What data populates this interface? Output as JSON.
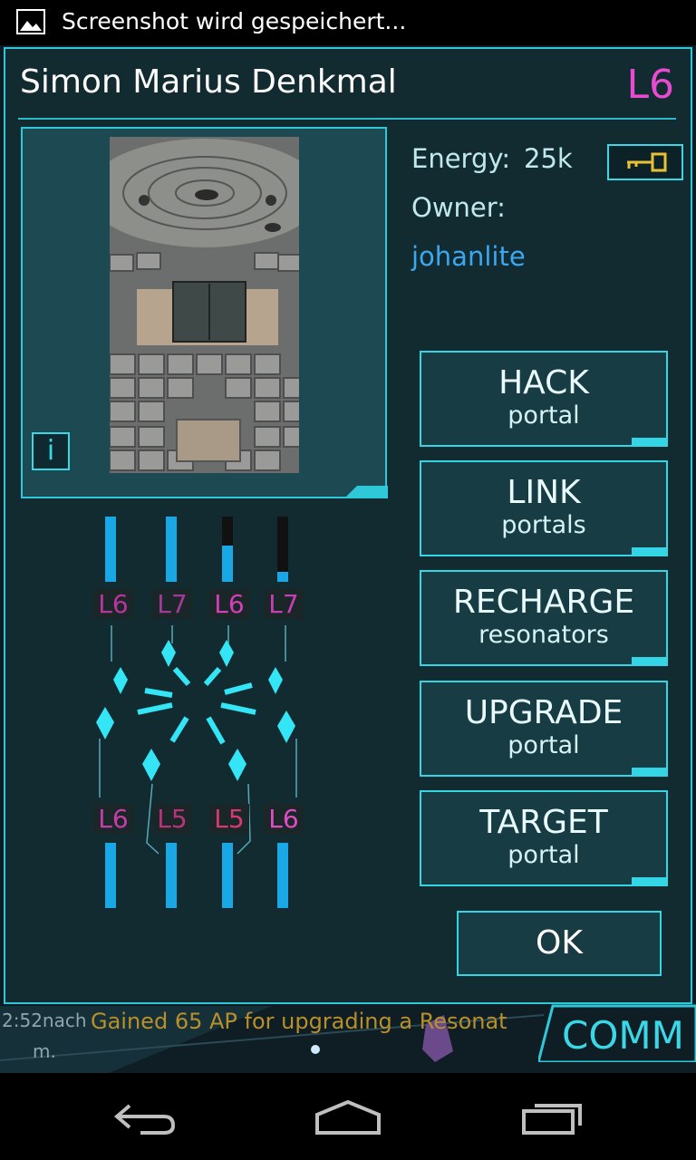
{
  "status_bar": {
    "notification": "Screenshot wird gespeichert...",
    "icon": "image-icon"
  },
  "portal": {
    "name": "Simon Marius Denkmal",
    "level": "L6",
    "energy_label": "Energy:",
    "energy_value": "25k",
    "owner_label": "Owner:",
    "owner": "johanlite",
    "key_icon": "key-icon",
    "info_label": "i"
  },
  "actions": [
    {
      "main": "HACK",
      "sub": "portal"
    },
    {
      "main": "LINK",
      "sub": "portals"
    },
    {
      "main": "RECHARGE",
      "sub": "resonators"
    },
    {
      "main": "UPGRADE",
      "sub": "portal"
    },
    {
      "main": "TARGET",
      "sub": "portal"
    }
  ],
  "ok_label": "OK",
  "resonators": {
    "top": [
      {
        "level": "L6",
        "energy": 1.0
      },
      {
        "level": "L7",
        "energy": 1.0
      },
      {
        "level": "L6",
        "energy": 0.55
      },
      {
        "level": "L7",
        "energy": 0.15
      }
    ],
    "bottom": [
      {
        "level": "L6",
        "energy": 1.0
      },
      {
        "level": "L5",
        "energy": 1.0
      },
      {
        "level": "L5",
        "energy": 1.0
      },
      {
        "level": "L6",
        "energy": 1.0
      }
    ]
  },
  "comm": {
    "tab_label": "COMM",
    "time": "2:52nach",
    "message": "Gained 65 AP for upgrading a Resonat",
    "line2": "m."
  },
  "colors": {
    "accent": "#2fc8d8",
    "level_magenta": "#e94bd0",
    "owner_blue": "#3aa8f0",
    "energy_fill": "#1aa7e6"
  }
}
